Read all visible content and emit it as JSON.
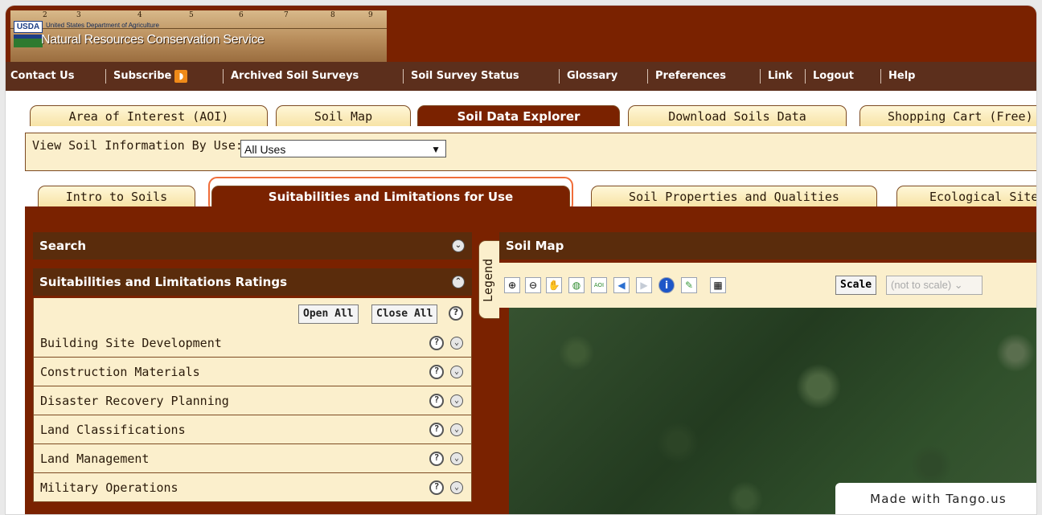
{
  "header": {
    "org_abbrev": "USDA",
    "department": "United States Department of Agriculture",
    "agency": "Natural Resources Conservation Service",
    "ruler_marks": [
      "2",
      "3",
      "4",
      "5",
      "6",
      "7",
      "8",
      "9"
    ]
  },
  "topnav": {
    "items": [
      {
        "label": "Contact Us"
      },
      {
        "label": "Subscribe"
      },
      {
        "label": "Archived Soil Surveys"
      },
      {
        "label": "Soil Survey Status"
      },
      {
        "label": "Glossary"
      },
      {
        "label": "Preferences"
      },
      {
        "label": "Link"
      },
      {
        "label": "Logout"
      },
      {
        "label": "Help"
      }
    ]
  },
  "main_tabs": [
    {
      "label": "Area of Interest (AOI)",
      "active": false
    },
    {
      "label": "Soil Map",
      "active": false
    },
    {
      "label": "Soil Data Explorer",
      "active": true
    },
    {
      "label": "Download Soils Data",
      "active": false
    },
    {
      "label": "Shopping Cart (Free)",
      "active": false
    }
  ],
  "view_by_use": {
    "label": "View Soil Information By Use:",
    "selected": "All Uses"
  },
  "sub_tabs": [
    {
      "label": "Intro to Soils",
      "active": false
    },
    {
      "label": "Suitabilities and Limitations for Use",
      "active": true
    },
    {
      "label": "Soil Properties and Qualities",
      "active": false
    },
    {
      "label": "Ecological Sites",
      "active": false
    }
  ],
  "left_panel": {
    "search_title": "Search",
    "ratings_title": "Suitabilities and Limitations Ratings",
    "open_all": "Open All",
    "close_all": "Close All",
    "categories": [
      "Building Site Development",
      "Construction Materials",
      "Disaster Recovery Planning",
      "Land Classifications",
      "Land Management",
      "Military Operations"
    ]
  },
  "legend_tab": "Legend",
  "map_panel": {
    "title": "Soil Map",
    "scale_label": "Scale",
    "scale_value": "(not to scale)",
    "tools": [
      "zoom-in-icon",
      "zoom-out-icon",
      "pan-icon",
      "full-extent-icon",
      "define-aoi-icon",
      "back-icon",
      "forward-icon",
      "identify-icon",
      "measure-icon",
      "layers-icon"
    ]
  },
  "watermark": "Made with Tango.us",
  "colors": {
    "header_brown": "#7a2200",
    "nav_brown": "#5c2f1c",
    "tab_cream": "#fbefcc",
    "highlight_orange": "#f06d3a"
  }
}
